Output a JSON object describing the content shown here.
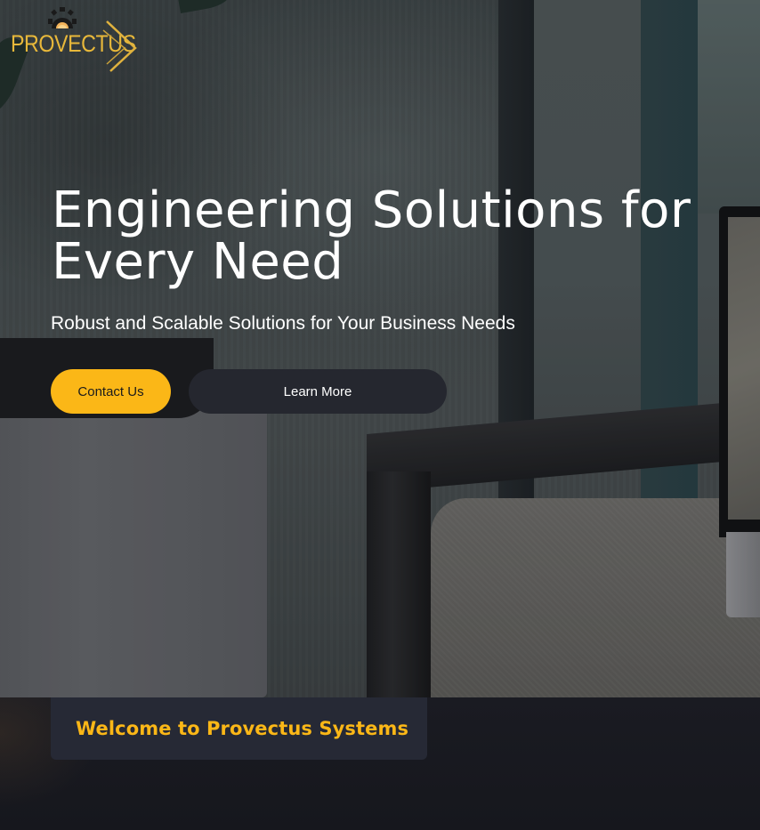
{
  "brand": {
    "logo_text": "PROVECTUS",
    "accent_color": "#fbb717"
  },
  "hero": {
    "headline": "Engineering Solutions for Every Need",
    "subheadline": "Robust and Scalable Solutions for Your Business Needs",
    "primary_button_label": "Contact Us",
    "secondary_button_label": "Learn More"
  },
  "welcome": {
    "title": "Welcome to Provectus Systems"
  },
  "icons": [
    "gear-icon",
    "chevron-right-icon"
  ]
}
